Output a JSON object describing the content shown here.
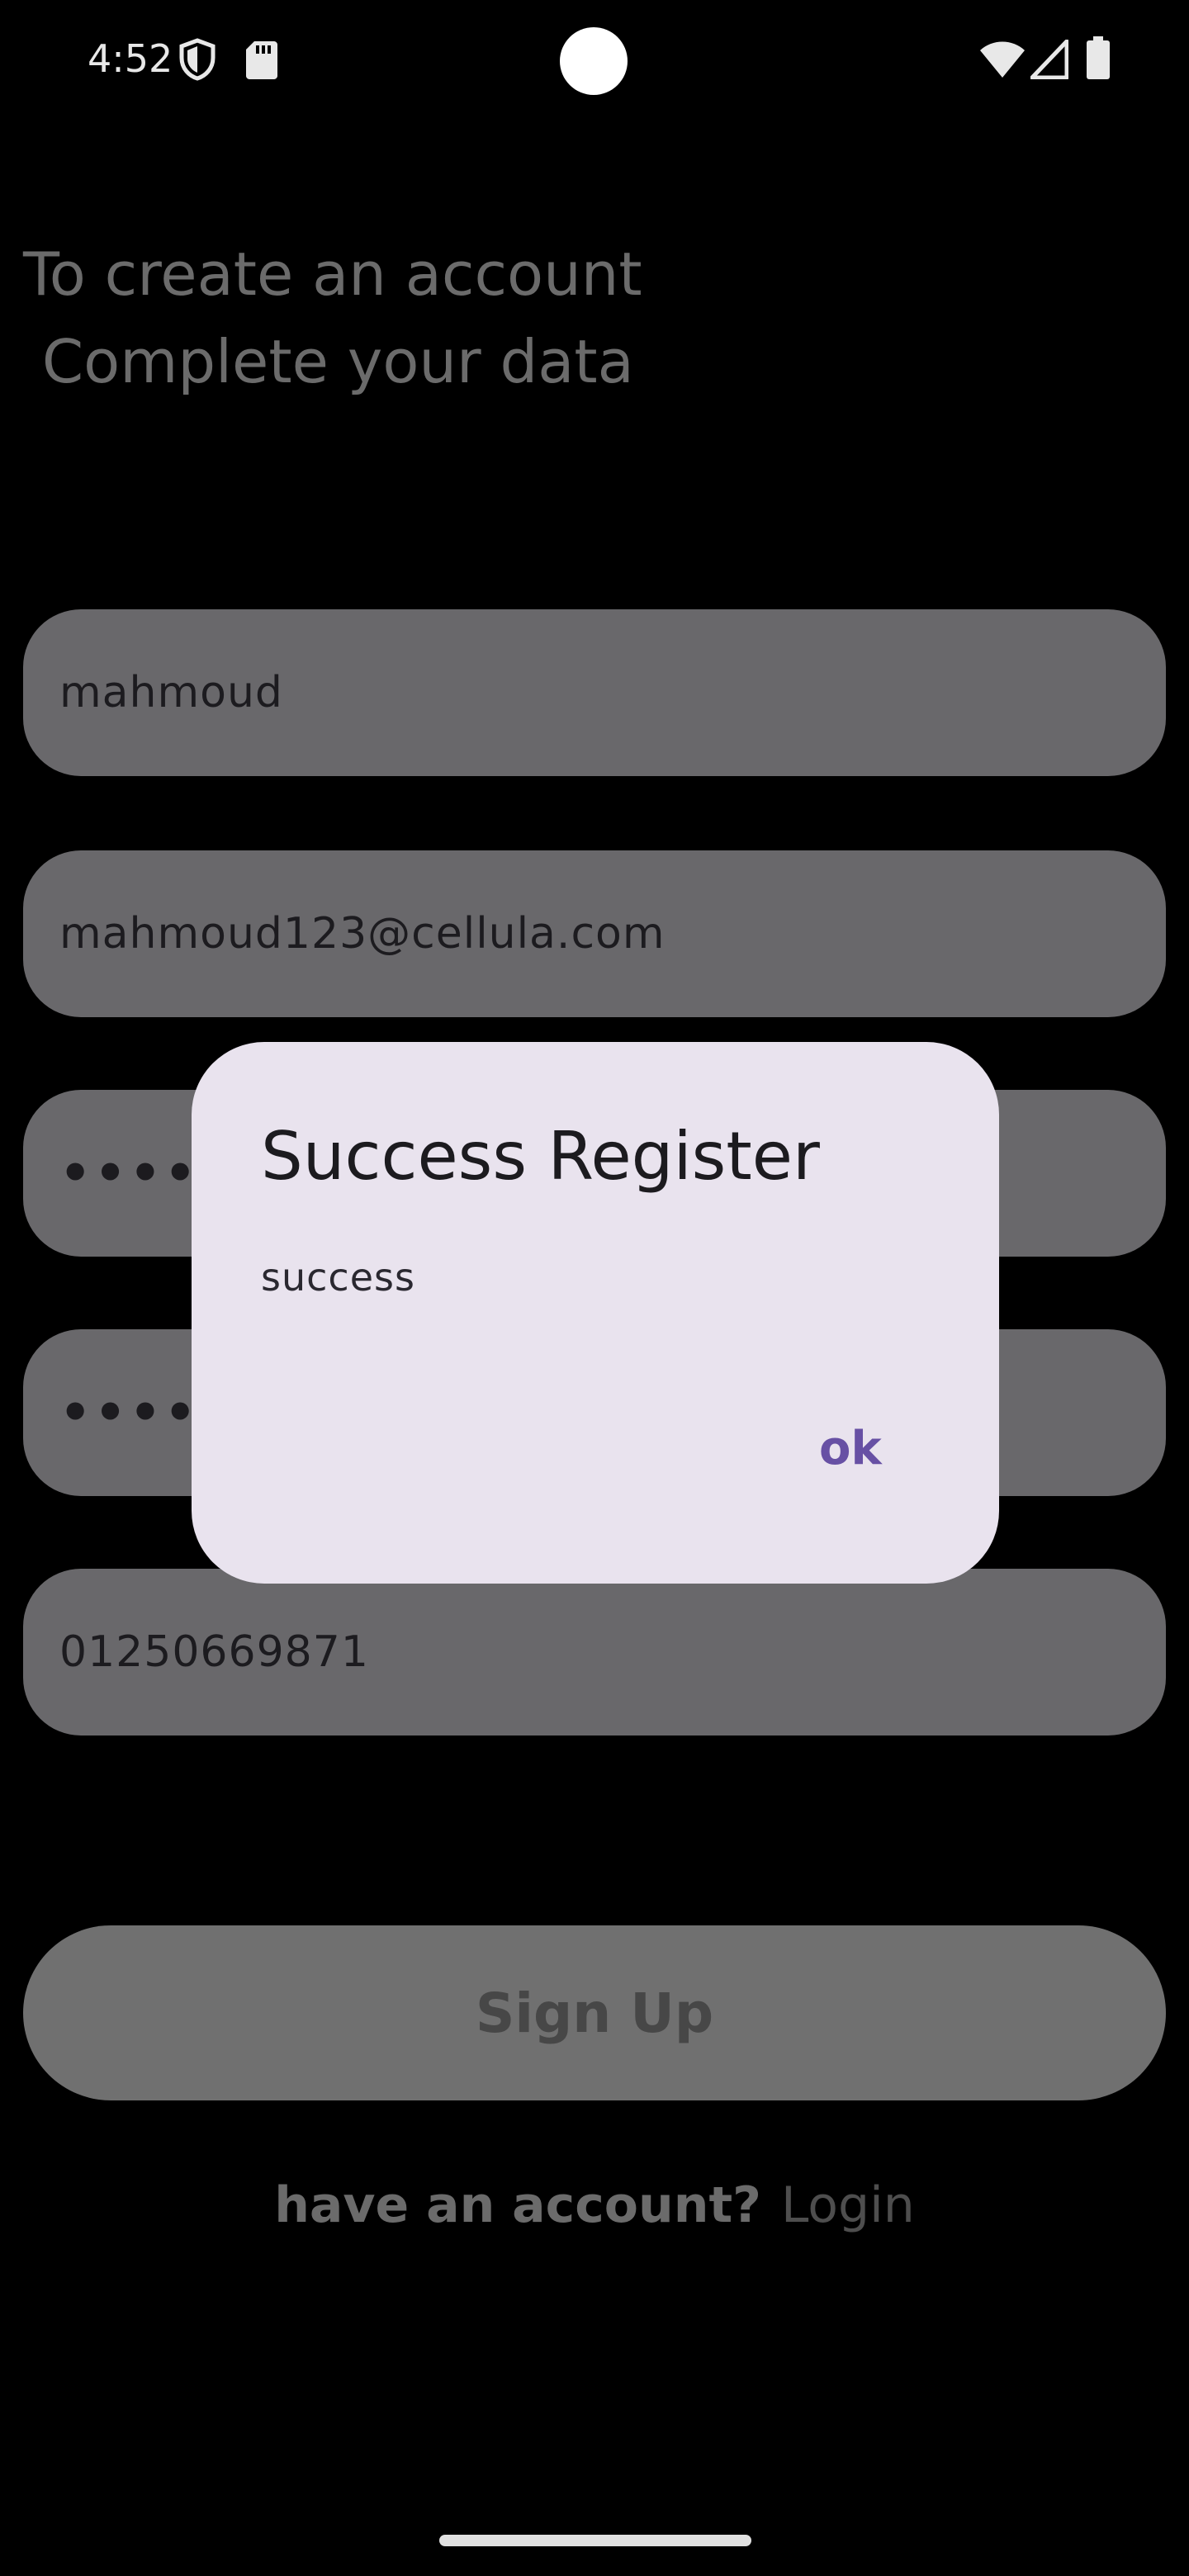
{
  "status_bar": {
    "time": "4:52",
    "icons_left": [
      "shield-icon",
      "sd-card-icon"
    ],
    "icons_right": [
      "wifi-icon",
      "cellular-signal-icon",
      "battery-icon"
    ]
  },
  "header": {
    "line1": "To create an account",
    "line2": " Complete your data"
  },
  "form": {
    "name_value": "mahmoud",
    "email_value": "mahmoud123@cellula.com",
    "password_value": "••••••",
    "confirm_password_value": "••••••",
    "phone_value": "01250669871"
  },
  "actions": {
    "signup_label": "Sign Up",
    "have_account_text": "have an account?",
    "login_label": "Login"
  },
  "dialog": {
    "title": "Success Register",
    "message": "success",
    "ok_label": "ok"
  },
  "colors": {
    "background": "#000000",
    "field": "#69686b",
    "dialog_bg": "#e9e3ee",
    "accent": "#6750a4"
  }
}
